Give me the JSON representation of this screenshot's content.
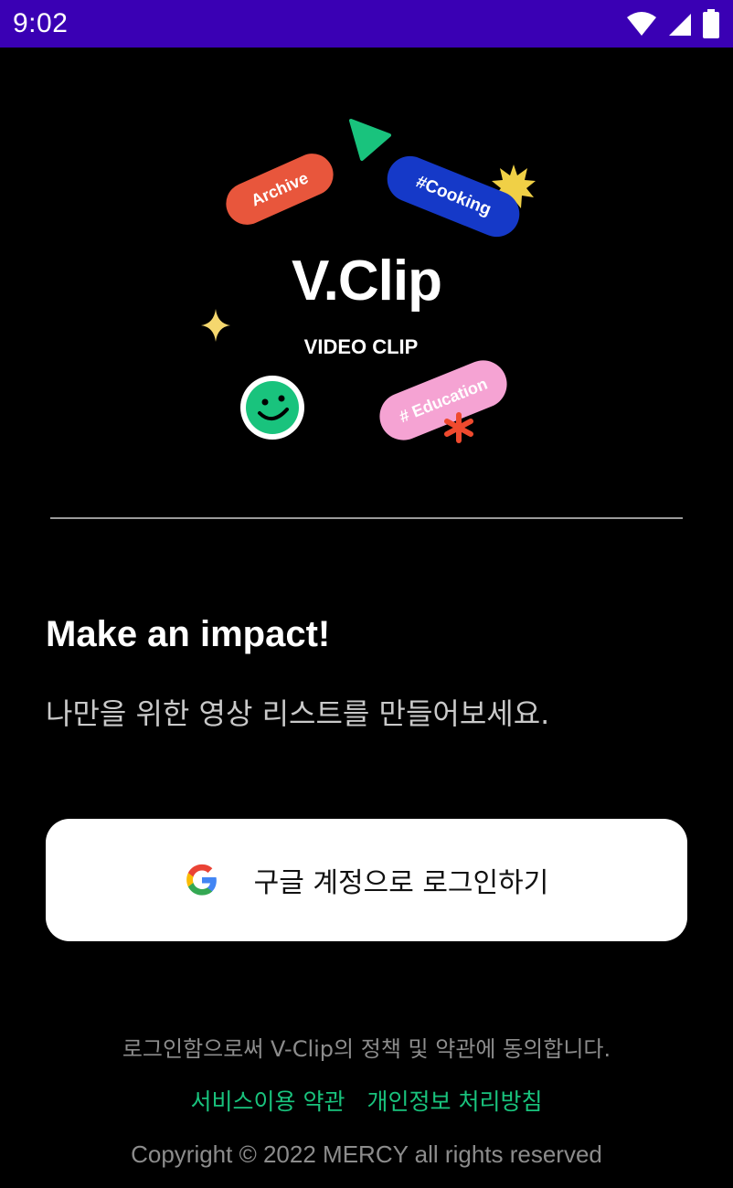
{
  "status_bar": {
    "time": "9:02",
    "background": "#3A00B4",
    "icons": [
      "wifi-icon",
      "cell-signal-icon",
      "battery-icon"
    ]
  },
  "logo": {
    "title": "V.Clip",
    "subtitle": "VIDEO CLIP",
    "stickers": {
      "archive": "Archive",
      "cooking": "#Cooking",
      "education": "# Education"
    },
    "colors": {
      "archive": "#E8563C",
      "cooking": "#1539C8",
      "education": "#F5A3D3",
      "play": "#19C37D",
      "smiley": "#19C37D",
      "burst": "#F0D046",
      "sparkle": "#F5D76E",
      "asterisk": "#F04A2E"
    }
  },
  "main": {
    "headline": "Make an impact!",
    "subtitle": "나만을 위한 영상 리스트를 만들어보세요."
  },
  "login": {
    "google_button_label": "구글 계정으로 로그인하기",
    "icon": "google-g-icon"
  },
  "footer": {
    "agree_text": "로그인함으로써 V-Clip의 정책 및 약관에 동의합니다.",
    "terms_link": "서비스이용 약관",
    "privacy_link": "개인정보 처리방침",
    "copyright": "Copyright © 2022 MERCY all rights reserved",
    "link_color": "#19C37D"
  }
}
